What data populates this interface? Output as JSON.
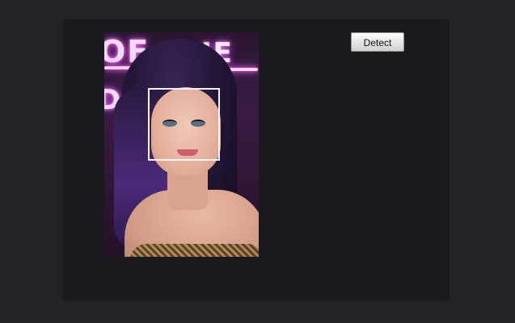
{
  "toolbar": {
    "detect_label": "Detect"
  },
  "photo": {
    "background_sign_text_top_left": "OE",
    "background_sign_text_top_right": "IE",
    "background_sign_text_mid_left": "D"
  },
  "detection": {
    "faces_detected_box_color": "#f4f4f4"
  },
  "colors": {
    "page_background": "#222326",
    "canvas_background": "#1b1b1f",
    "button_face": "#e3e3e3"
  }
}
